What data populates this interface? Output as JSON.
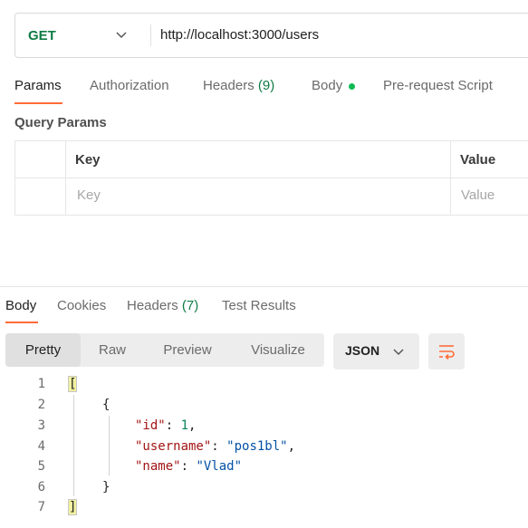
{
  "request": {
    "method": "GET",
    "url": "http://localhost:3000/users"
  },
  "request_tabs": [
    {
      "label": "Params",
      "count": ""
    },
    {
      "label": "Authorization",
      "count": ""
    },
    {
      "label": "Headers",
      "count": "(9)"
    },
    {
      "label": "Body",
      "count": ""
    },
    {
      "label": "Pre-request Script",
      "count": ""
    }
  ],
  "query_params": {
    "title": "Query Params",
    "col_key": "Key",
    "col_value": "Value",
    "placeholder_key": "Key",
    "placeholder_value": "Value"
  },
  "response_tabs": [
    {
      "label": "Body",
      "count": ""
    },
    {
      "label": "Cookies",
      "count": ""
    },
    {
      "label": "Headers",
      "count": "(7)"
    },
    {
      "label": "Test Results",
      "count": ""
    }
  ],
  "view_modes": [
    "Pretty",
    "Raw",
    "Preview",
    "Visualize"
  ],
  "format": "JSON",
  "code": {
    "line_numbers": [
      "1",
      "2",
      "3",
      "4",
      "5",
      "6",
      "7"
    ],
    "open_array": "[",
    "open_obj": "{",
    "k_id": "\"id\"",
    "v_id": "1",
    "k_username": "\"username\"",
    "v_username": "\"pos1bl\"",
    "k_name": "\"name\"",
    "v_name": "\"Vlad\"",
    "close_obj": "}",
    "close_array": "]"
  },
  "colors": {
    "accent": "#ff6c37",
    "method": "#0f7b45",
    "status_dot": "#0cbb52"
  }
}
